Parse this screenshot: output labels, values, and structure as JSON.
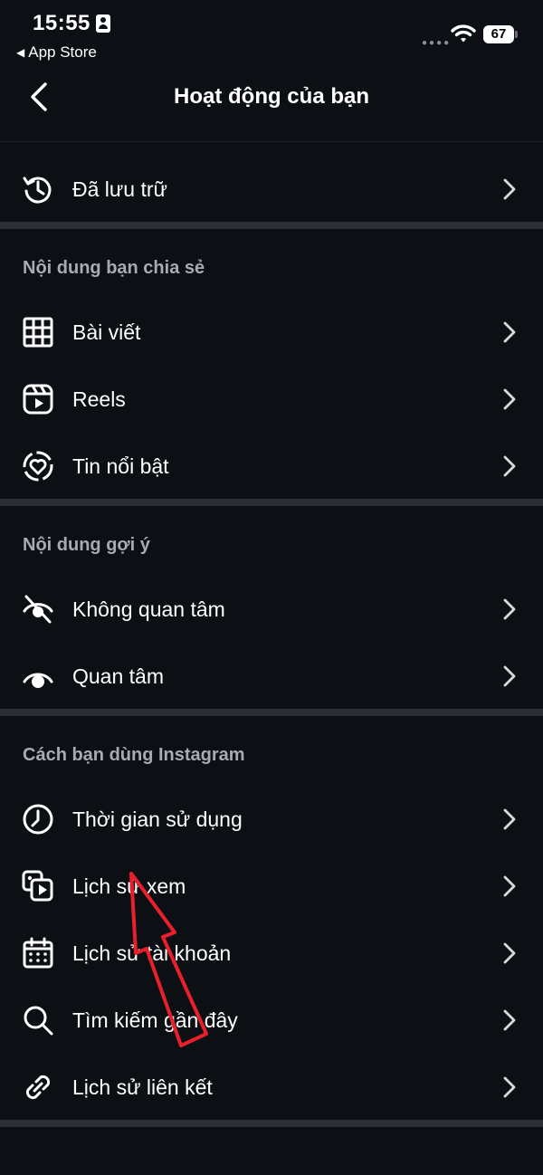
{
  "status_bar": {
    "time": "15:55",
    "back_app": "App Store",
    "battery": "67"
  },
  "nav": {
    "title": "Hoạt động của bạn"
  },
  "archived": {
    "label": "Đã lưu trữ",
    "icon": "archive-history-icon"
  },
  "section_shared": {
    "header": "Nội dung bạn chia sẻ",
    "items": [
      {
        "label": "Bài viết",
        "icon": "grid-icon"
      },
      {
        "label": "Reels",
        "icon": "reels-icon"
      },
      {
        "label": "Tin nổi bật",
        "icon": "highlights-icon"
      }
    ]
  },
  "section_suggested": {
    "header": "Nội dung gợi ý",
    "items": [
      {
        "label": "Không quan tâm",
        "icon": "eye-off-icon"
      },
      {
        "label": "Quan tâm",
        "icon": "eye-icon"
      }
    ]
  },
  "section_usage": {
    "header": "Cách bạn dùng Instagram",
    "items": [
      {
        "label": "Thời gian sử dụng",
        "icon": "clock-icon"
      },
      {
        "label": "Lịch sử xem",
        "icon": "watch-history-icon"
      },
      {
        "label": "Lịch sử tài khoản",
        "icon": "calendar-icon"
      },
      {
        "label": "Tìm kiếm gần đây",
        "icon": "search-icon"
      },
      {
        "label": "Lịch sử liên kết",
        "icon": "link-icon"
      }
    ]
  },
  "colors": {
    "background": "#0c0f14",
    "divider": "#2a2e35",
    "section_header": "#a7abb2",
    "annotation_arrow": "#e8202a"
  }
}
